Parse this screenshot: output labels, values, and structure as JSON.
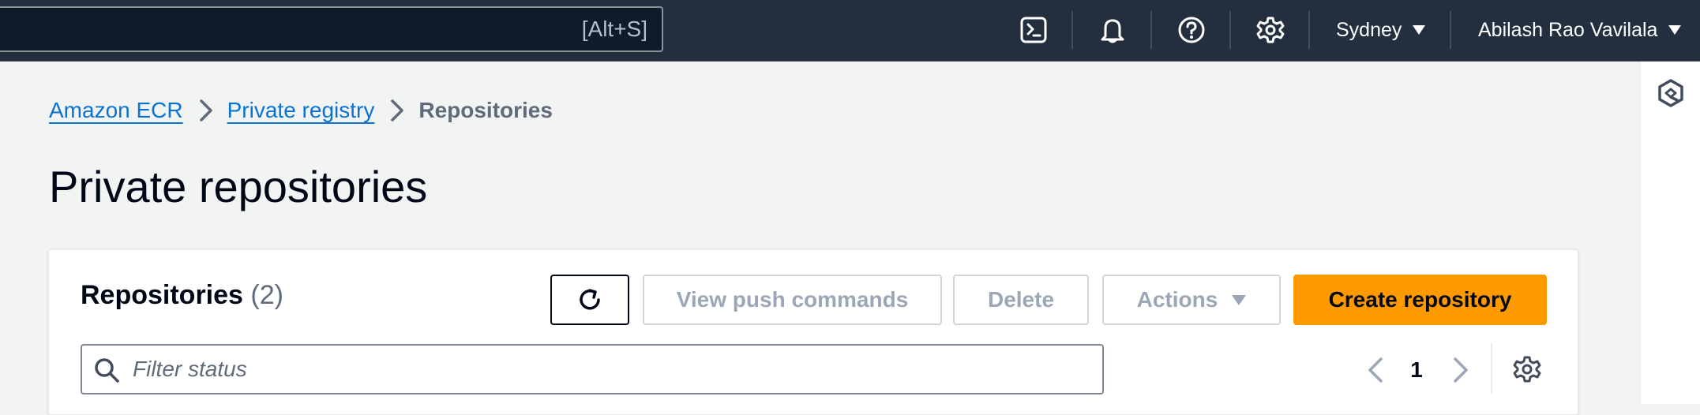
{
  "topbar": {
    "search_shortcut": "[Alt+S]",
    "region": "Sydney",
    "user": "Abilash Rao Vavilala",
    "icons": [
      "cloudshell-icon",
      "notifications-bell-icon",
      "help-icon",
      "settings-gear-icon"
    ]
  },
  "breadcrumb": {
    "items": [
      {
        "label": "Amazon ECR"
      },
      {
        "label": "Private registry"
      },
      {
        "label": "Repositories"
      }
    ]
  },
  "page": {
    "title": "Private repositories"
  },
  "repositories": {
    "heading": "Repositories",
    "count": "(2)",
    "buttons": {
      "view_push_commands": "View push commands",
      "delete": "Delete",
      "actions": "Actions",
      "create": "Create repository"
    },
    "filter_placeholder": "Filter status",
    "pagination": {
      "current_page": "1"
    }
  },
  "colors": {
    "topbar_bg": "#232f3e",
    "primary_button": "#ff9900",
    "link": "#0972d3",
    "disabled_text": "#9ba7b6"
  }
}
